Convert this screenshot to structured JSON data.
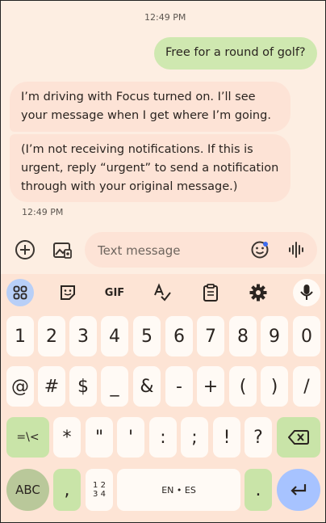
{
  "chat": {
    "time_top": "12:49 PM",
    "outgoing": "Free for a round of golf?",
    "incoming_1": "I’m driving with Focus turned on. I’ll see your message when I get where I’m going.",
    "incoming_2": "(I’m not receiving notifications. If this is urgent, reply “urgent” to send a notification through with your original message.)",
    "time_bottom": "12:49 PM"
  },
  "composer": {
    "placeholder": "Text message"
  },
  "keyboard": {
    "toolbar": {
      "gif": "GIF"
    },
    "row1": [
      "1",
      "2",
      "3",
      "4",
      "5",
      "6",
      "7",
      "8",
      "9",
      "0"
    ],
    "row2": [
      "@",
      "#",
      "$",
      "_",
      "&",
      "-",
      "+",
      "(",
      ")",
      "/"
    ],
    "row3_mode": "=\\<",
    "row3": [
      "*",
      "\"",
      "'",
      ":",
      ";",
      "!",
      "?"
    ],
    "row4": {
      "abc": "ABC",
      "comma": ",",
      "numpad_top": "1 2",
      "numpad_bottom": "3 4",
      "space": "EN • ES",
      "period": "."
    }
  },
  "colors": {
    "background": "#fdeee2",
    "outgoing_bubble": "#cfe8b0",
    "incoming_bubble": "#fde3d6",
    "key": "#fffaf5",
    "key_special": "#c9e4a8",
    "enter_key": "#a7c3ff"
  }
}
